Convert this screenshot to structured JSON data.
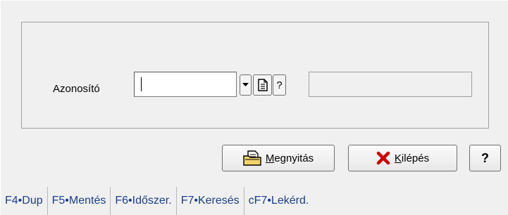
{
  "form": {
    "field_label": "Azonosító",
    "field_value": "",
    "help_small_label": "?",
    "readonly_value": ""
  },
  "buttons": {
    "open_label_first": "M",
    "open_label_rest": "egnyitás",
    "exit_label_first": "K",
    "exit_label_rest": "ilépés",
    "help_label": "?"
  },
  "fkeys": [
    "F4•Dup",
    "F5•Mentés",
    "F6•Időszer.",
    "F7•Keresés",
    "cF7•Lekérd."
  ],
  "colors": {
    "background": "#f0f0f0",
    "fkey_text": "#1a3f8a",
    "exit_icon": "#cc0000"
  },
  "icons": {
    "dropdown": "chevron-down-icon",
    "document": "document-icon",
    "open": "open-document-icon",
    "exit": "x-close-icon"
  }
}
